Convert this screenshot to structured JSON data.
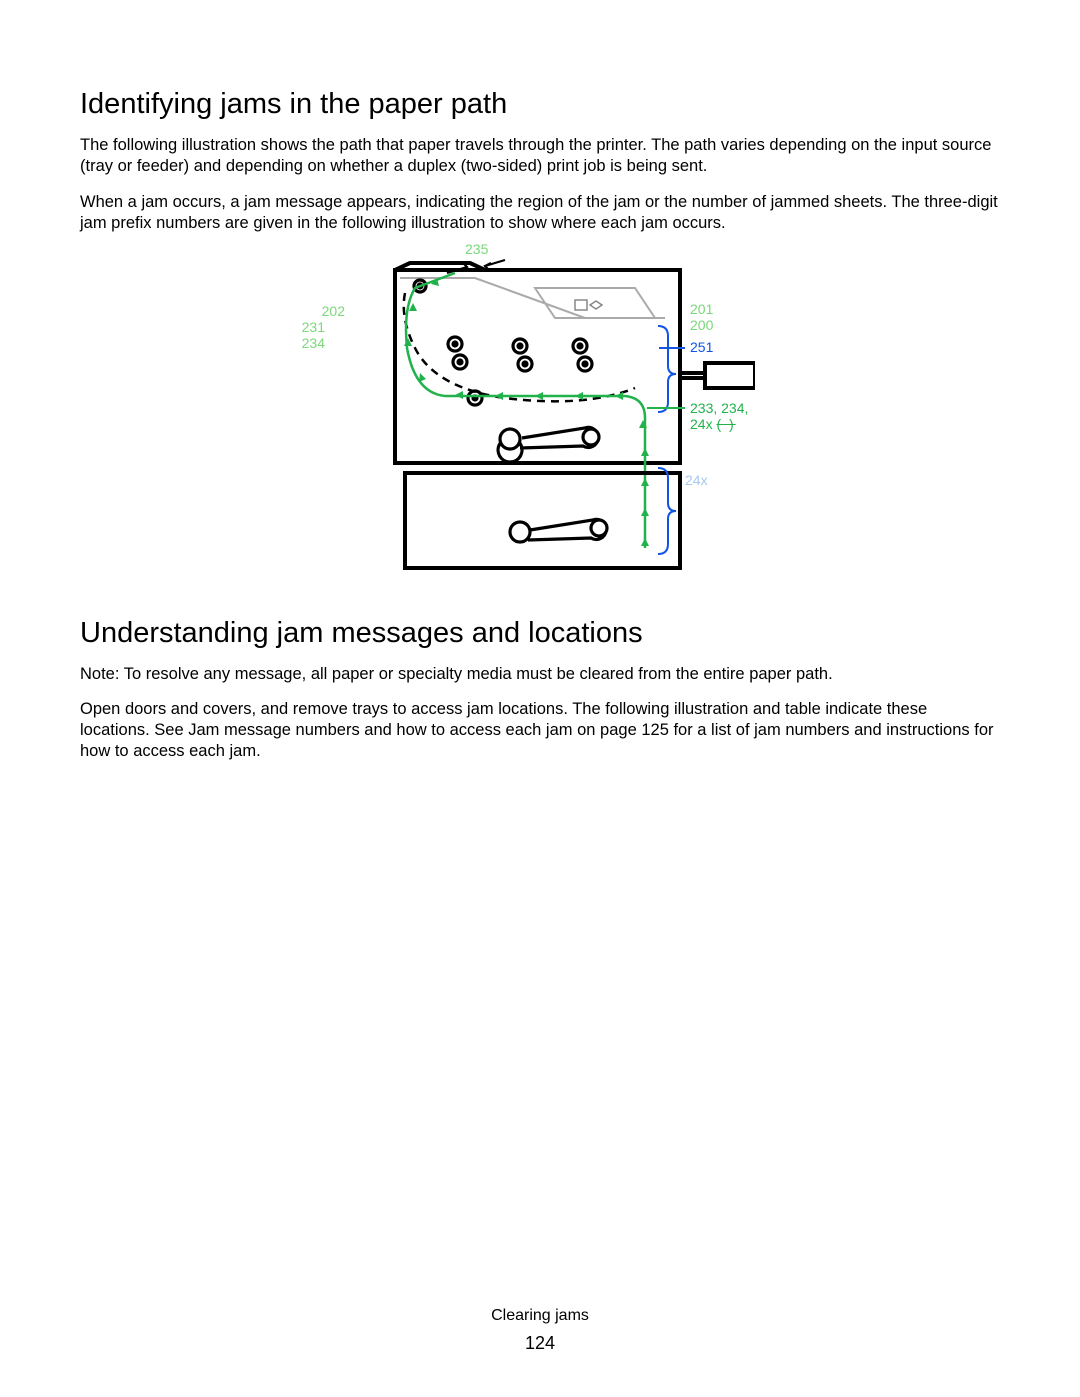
{
  "section1": {
    "heading": "Identifying jams in the paper path",
    "p1": "The following illustration shows the path that paper travels through the printer. The path varies depending on the input source (tray or feeder) and depending on whether a duplex (two-sided) print job is being sent.",
    "p2": "When a jam occurs, a jam message appears, indicating the region of the jam or the number of jammed sheets. The three-digit jam prefix numbers are given in the following illustration to show where each jam occurs."
  },
  "diagram": {
    "labels": {
      "top_235": "235",
      "l_202": "202",
      "l_231": "231",
      "l_234": "234",
      "r_201": "201",
      "r_200": "200",
      "r_251": "251",
      "r_233_234": "233, 234,",
      "r_24x": "24x",
      "r_24x_paren": "(       )",
      "r_lower_24x": "24x"
    }
  },
  "section2": {
    "heading": "Understanding jam messages and locations",
    "note": "Note: To resolve any message, all paper or specialty media must be cleared from the entire paper path.",
    "p1_a": "Open doors and covers, and remove trays to access jam locations. The following illustration and table indicate these locations. See ",
    "p1_link": "Jam message numbers and how to access each jam",
    "p1_b": " on page 125 for a list of jam numbers and instructions for how to access each jam."
  },
  "footer": {
    "chapter": "Clearing jams",
    "page_number": "124"
  }
}
